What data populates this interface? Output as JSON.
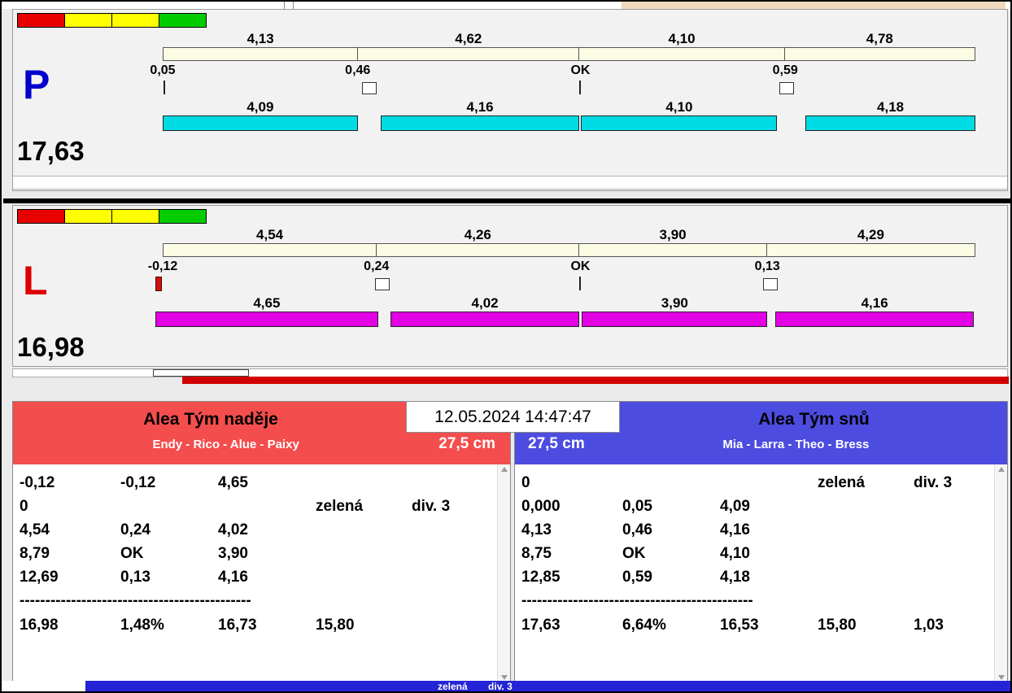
{
  "window": {
    "top_corner_color": "#f2d9bd"
  },
  "lanes": [
    {
      "letter": "P",
      "letter_color": "#0000cc",
      "total": "17,63",
      "split_bar_color": "#00dce6",
      "lights": [
        "#e80000",
        "#ffff00",
        "#ffff00",
        "#00cc00"
      ],
      "upper_splits": [
        "4,13",
        "4,62",
        "4,10",
        "4,78"
      ],
      "changes": [
        "0,05",
        "0,46",
        "OK",
        "0,59"
      ],
      "lower_splits": [
        "4,09",
        "4,16",
        "4,10",
        "4,18"
      ]
    },
    {
      "letter": "L",
      "letter_color": "#dd0000",
      "total": "16,98",
      "split_bar_color": "#e302e3",
      "lights": [
        "#e80000",
        "#ffff00",
        "#ffff00",
        "#00cc00"
      ],
      "upper_splits": [
        "4,54",
        "4,26",
        "3,90",
        "4,29"
      ],
      "changes": [
        "-0,12",
        "0,24",
        "OK",
        "0,13"
      ],
      "lower_splits": [
        "4,65",
        "4,02",
        "3,90",
        "4,16"
      ]
    }
  ],
  "datetime": "12.05.2024 14:47:47",
  "teams": [
    {
      "name": "Alea Tým naděje",
      "members": "Endy - Rico - Alue - Paixy",
      "jump_height": "27,5 cm",
      "header_color": "#f44d4d",
      "rows": [
        [
          "-0,12",
          "-0,12",
          "4,65",
          "",
          ""
        ],
        [
          "0",
          "",
          "",
          "zelená",
          "div. 3"
        ],
        [
          "4,54",
          "0,24",
          "4,02",
          "",
          ""
        ],
        [
          "8,79",
          "OK",
          "3,90",
          "",
          ""
        ],
        [
          "12,69",
          "0,13",
          "4,16",
          "",
          ""
        ]
      ],
      "separator": "---------------------------------------------",
      "summary": [
        "16,98",
        "1,48%",
        "16,73",
        "15,80",
        ""
      ]
    },
    {
      "name": "Alea Tým snů",
      "members": "Mia - Larra - Theo - Bress",
      "jump_height": "27,5 cm",
      "header_color": "#4c4ce0",
      "rows": [
        [
          "0",
          "",
          "",
          "zelená",
          "div. 3"
        ],
        [
          "0,000",
          "0,05",
          "4,09",
          "",
          ""
        ],
        [
          "4,13",
          "0,46",
          "4,16",
          "",
          ""
        ],
        [
          "8,75",
          "OK",
          "4,10",
          "",
          ""
        ],
        [
          "12,85",
          "0,59",
          "4,18",
          "",
          ""
        ]
      ],
      "separator": "---------------------------------------------",
      "summary": [
        "17,63",
        "6,64%",
        "16,53",
        "15,80",
        "1,03"
      ]
    }
  ],
  "status_bar": {
    "color": "#2424d6",
    "label": "zelená",
    "division": "div. 3"
  }
}
